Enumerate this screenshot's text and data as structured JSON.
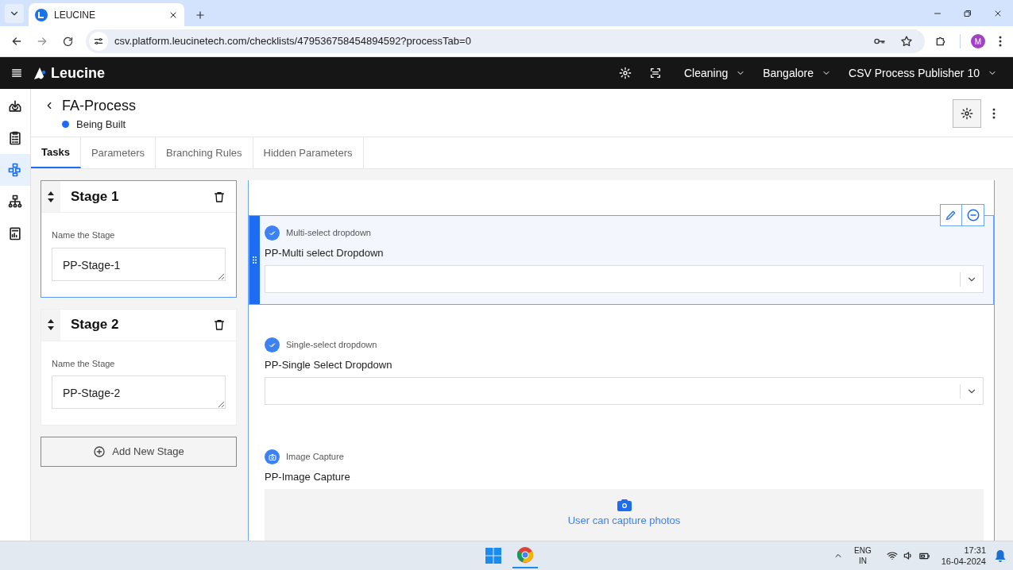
{
  "browser": {
    "tab_title": "LEUCINE",
    "url": "csv.platform.leucinetech.com/checklists/479536758454894592?processTab=0",
    "profile_initial": "M"
  },
  "header": {
    "brand": "Leucine",
    "menus": [
      {
        "label": "Cleaning"
      },
      {
        "label": "Bangalore"
      },
      {
        "label": "CSV Process Publisher 10"
      }
    ]
  },
  "rail": [
    {
      "selected": false
    },
    {
      "selected": false
    },
    {
      "selected": true
    },
    {
      "selected": false
    },
    {
      "selected": false
    }
  ],
  "process": {
    "title": "FA-Process",
    "status": "Being Built"
  },
  "tabs": [
    {
      "label": "Tasks",
      "selected": true
    },
    {
      "label": "Parameters",
      "selected": false
    },
    {
      "label": "Branching Rules",
      "selected": false
    },
    {
      "label": "Hidden Parameters",
      "selected": false
    }
  ],
  "stages": [
    {
      "title": "Stage 1",
      "field_label": "Name the Stage",
      "value": "PP-Stage-1",
      "selected": true
    },
    {
      "title": "Stage 2",
      "field_label": "Name the Stage",
      "value": "PP-Stage-2",
      "selected": false
    }
  ],
  "add_stage": "Add New Stage",
  "parameters": [
    {
      "kind": "multi_select",
      "type_label": "Multi-select dropdown",
      "name": "PP-Multi select Dropdown",
      "selected": true
    },
    {
      "kind": "single_select",
      "type_label": "Single-select dropdown",
      "name": "PP-Single Select Dropdown",
      "selected": false
    },
    {
      "kind": "image_capture",
      "type_label": "Image Capture",
      "name": "PP-Image Capture",
      "hint": "User can capture photos",
      "selected": false
    }
  ],
  "taskbar": {
    "lang": "ENG",
    "region": "IN",
    "time": "17:31",
    "date": "16-04-2024"
  }
}
